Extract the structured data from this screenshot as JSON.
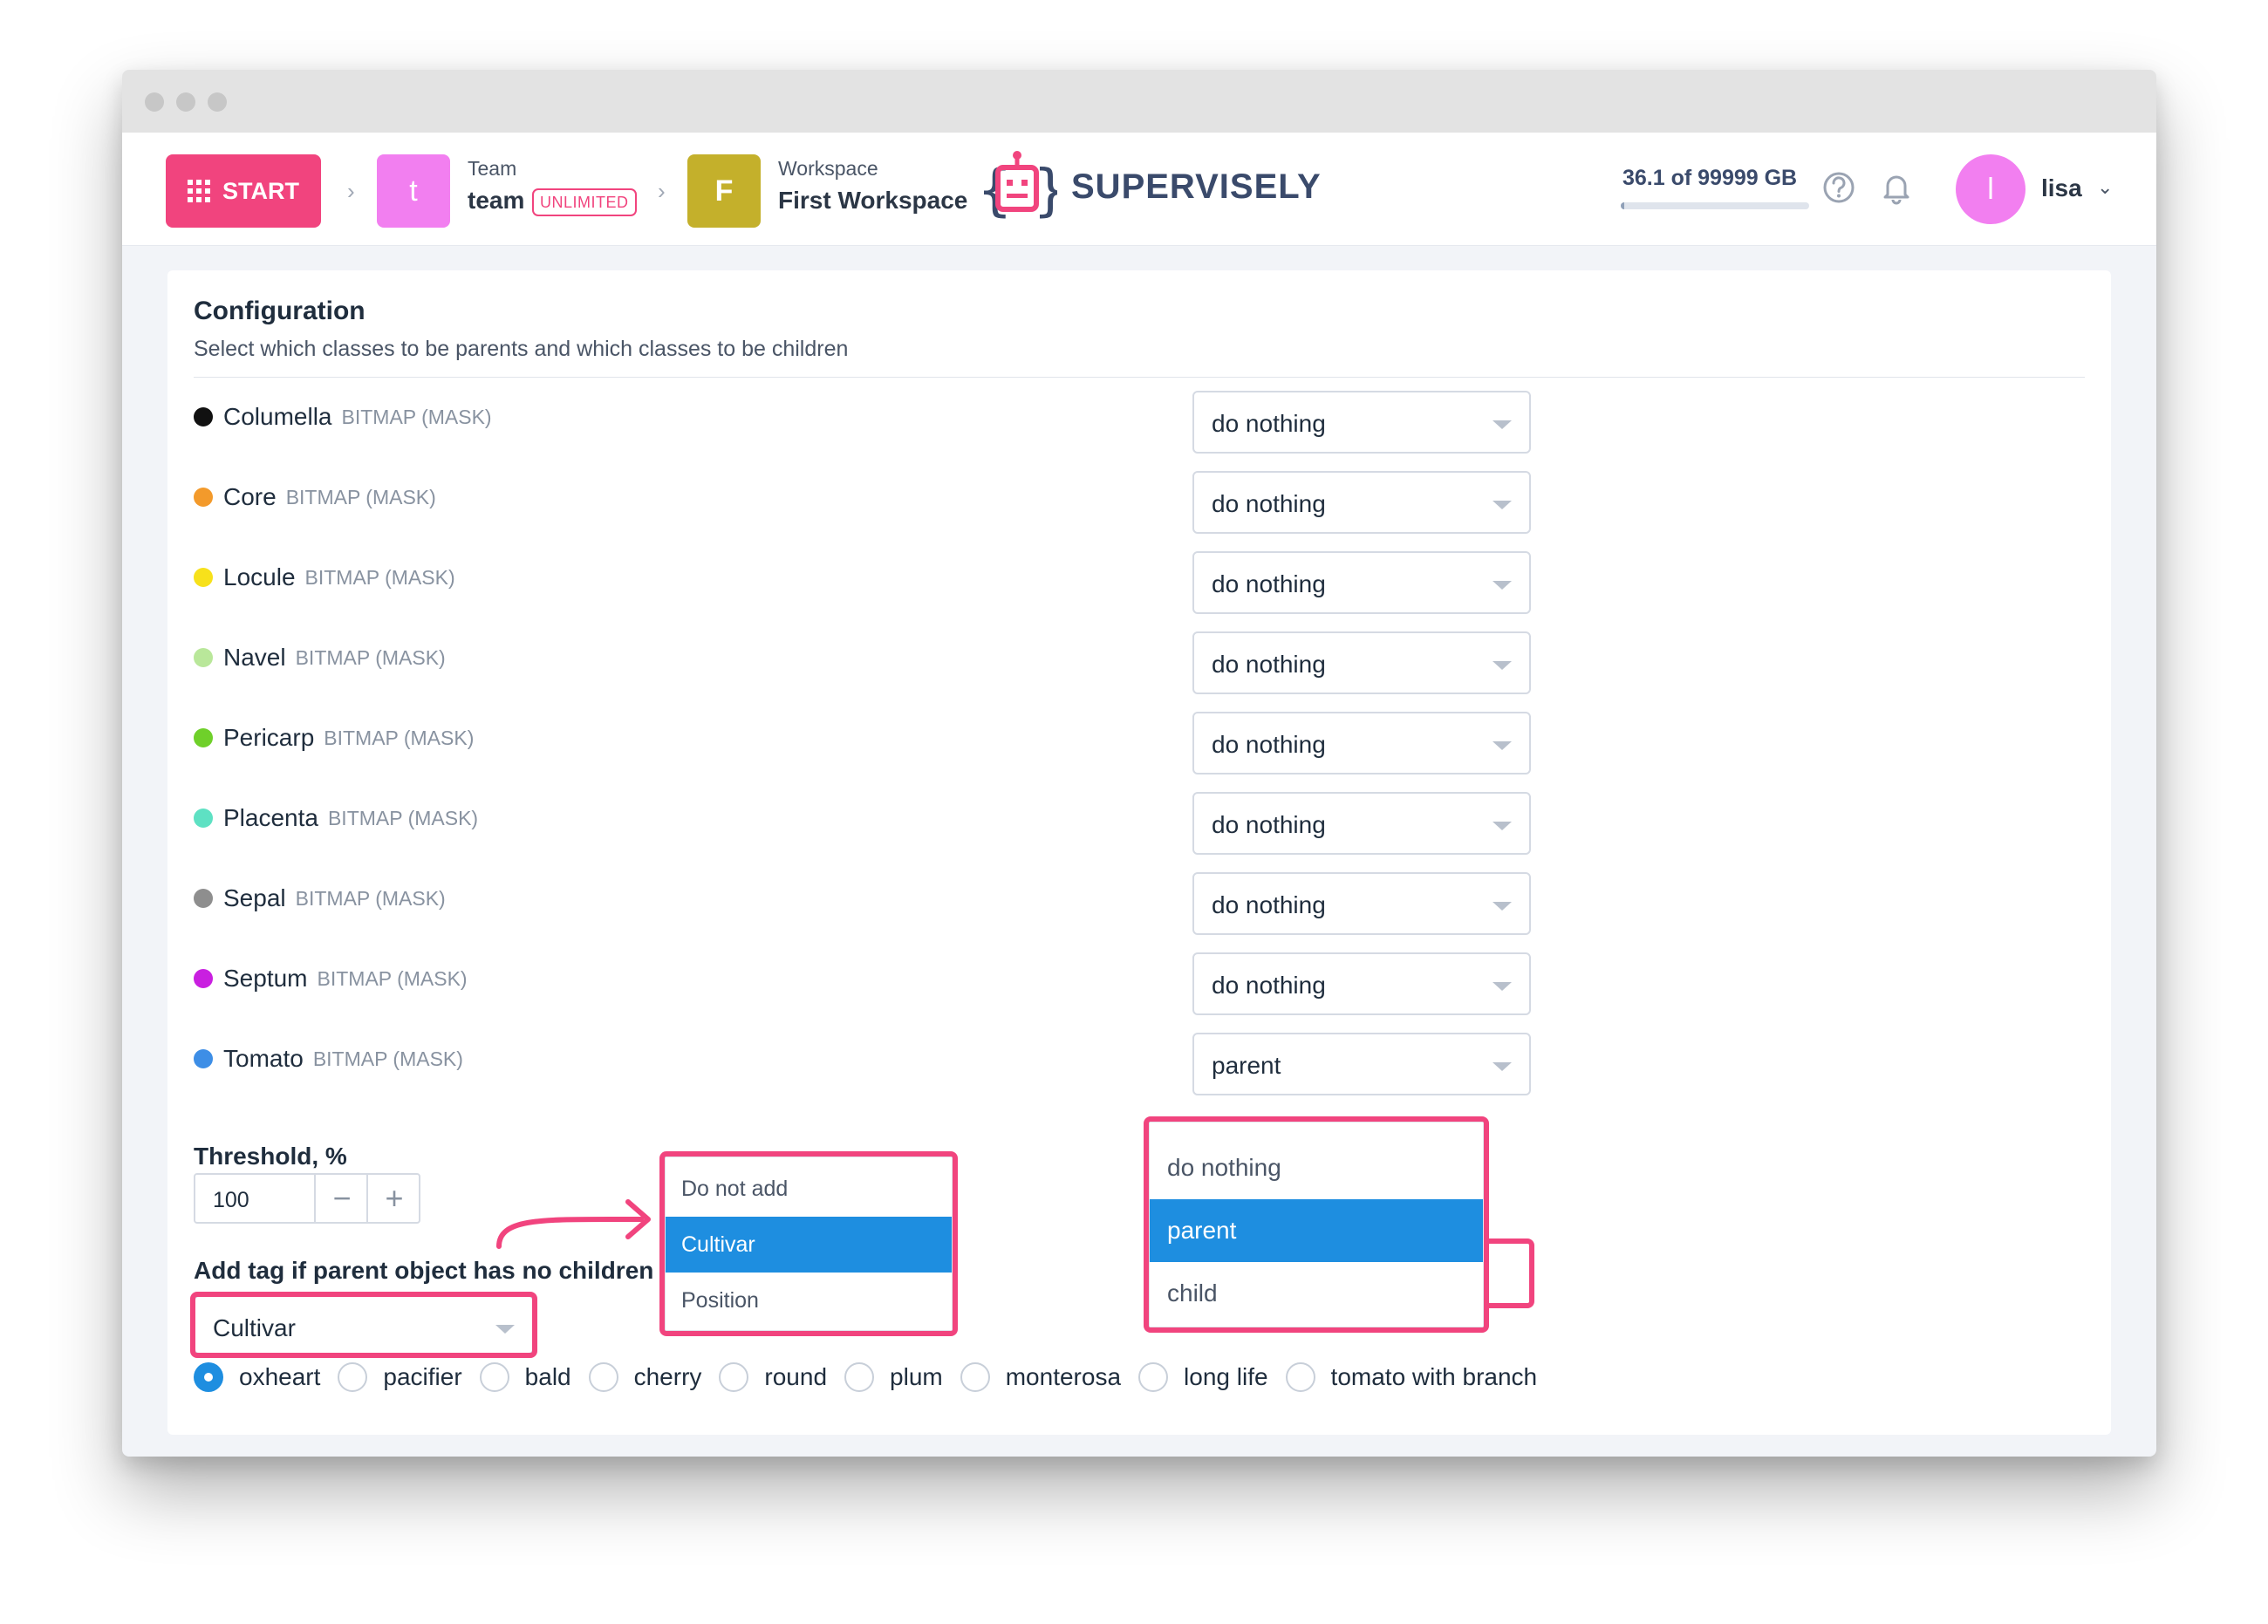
{
  "header": {
    "start_label": "START",
    "team_badge": "t",
    "team_caption": "Team",
    "team_name": "team",
    "team_plan": "UNLIMITED",
    "workspace_badge": "F",
    "workspace_caption": "Workspace",
    "workspace_name": "First Workspace",
    "brand": "SUPERVISELY",
    "storage_text": "36.1 of 99999 GB",
    "storage_used_fraction": 0.0004,
    "user_initial": "l",
    "user_name": "lisa"
  },
  "config": {
    "title": "Configuration",
    "subtitle": "Select which classes to be parents and which classes to be children",
    "classes": [
      {
        "name": "Columella",
        "type": "BITMAP (MASK)",
        "color": "#111111",
        "value": "do nothing"
      },
      {
        "name": "Core",
        "type": "BITMAP (MASK)",
        "color": "#f39a2b",
        "value": "do nothing"
      },
      {
        "name": "Locule",
        "type": "BITMAP (MASK)",
        "color": "#f7e11b",
        "value": "do nothing"
      },
      {
        "name": "Navel",
        "type": "BITMAP (MASK)",
        "color": "#b9e79a",
        "value": "do nothing"
      },
      {
        "name": "Pericarp",
        "type": "BITMAP (MASK)",
        "color": "#6fd02a",
        "value": "do nothing"
      },
      {
        "name": "Placenta",
        "type": "BITMAP (MASK)",
        "color": "#5ee1c3",
        "value": "do nothing"
      },
      {
        "name": "Sepal",
        "type": "BITMAP (MASK)",
        "color": "#8e8e8e",
        "value": "do nothing"
      },
      {
        "name": "Septum",
        "type": "BITMAP (MASK)",
        "color": "#c91fe0",
        "value": "do nothing"
      },
      {
        "name": "Tomato",
        "type": "BITMAP (MASK)",
        "color": "#3d8ee6",
        "value": "parent"
      }
    ],
    "role_options": [
      "do nothing",
      "parent",
      "child"
    ],
    "role_selected": "parent",
    "threshold_label": "Threshold, %",
    "threshold_value": "100",
    "tag_label": "Add tag if parent object has no children",
    "tag_value": "Cultivar",
    "tag_options": [
      "Do not add",
      "Cultivar",
      "Position"
    ],
    "tag_selected": "Cultivar",
    "cultivars": [
      "oxheart",
      "pacifier",
      "bald",
      "cherry",
      "round",
      "plum",
      "monterosa",
      "long life",
      "tomato with branch"
    ],
    "cultivar_selected": "oxheart"
  },
  "colors": {
    "accent": "#f1447e",
    "selection": "#1e8ee0",
    "team_badge": "#f27ff0",
    "workspace_badge": "#c4b02b"
  },
  "icons": [
    "grid-icon",
    "chevron-right-icon",
    "robot-logo-icon",
    "help-icon",
    "bell-icon",
    "chevron-down-icon",
    "minus-icon",
    "plus-icon",
    "arrow-icon"
  ]
}
